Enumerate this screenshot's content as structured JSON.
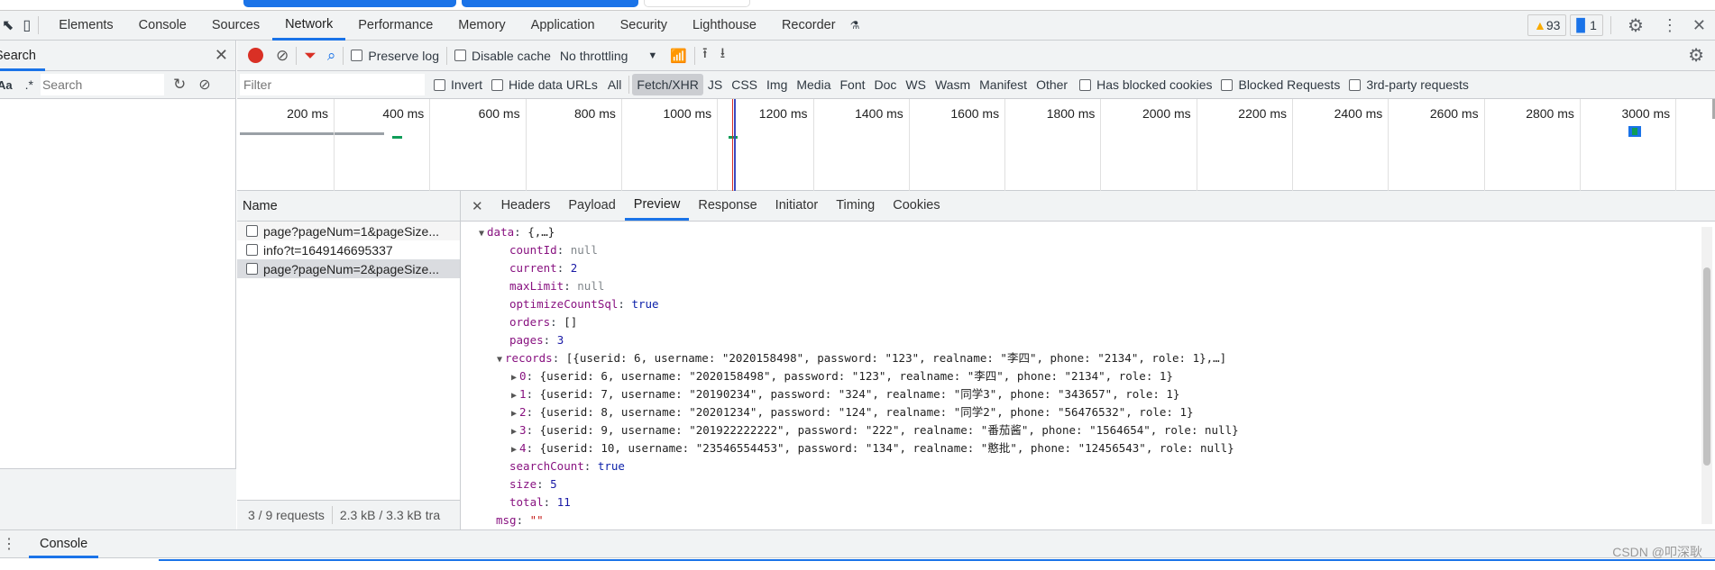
{
  "devtools": {
    "main_tabs": [
      "Elements",
      "Console",
      "Sources",
      "Network",
      "Performance",
      "Memory",
      "Application",
      "Security",
      "Lighthouse",
      "Recorder"
    ],
    "selected_tab": "Network",
    "warnings_count": "93",
    "messages_count": "1"
  },
  "search_panel": {
    "title": "Search",
    "aa_label": "Aa",
    "regex_label": ".*",
    "placeholder": "Search"
  },
  "network_toolbar": {
    "preserve_log": "Preserve log",
    "disable_cache": "Disable cache",
    "throttling": "No throttling"
  },
  "filter_bar": {
    "placeholder": "Filter",
    "invert": "Invert",
    "hide_data_urls": "Hide data URLs",
    "types": [
      "All",
      "Fetch/XHR",
      "JS",
      "CSS",
      "Img",
      "Media",
      "Font",
      "Doc",
      "WS",
      "Wasm",
      "Manifest",
      "Other"
    ],
    "selected_type": "Fetch/XHR",
    "has_blocked_cookies": "Has blocked cookies",
    "blocked_requests": "Blocked Requests",
    "third_party": "3rd-party requests"
  },
  "timeline": {
    "ticks": [
      "200 ms",
      "400 ms",
      "600 ms",
      "800 ms",
      "1000 ms",
      "1200 ms",
      "1400 ms",
      "1600 ms",
      "1800 ms",
      "2000 ms",
      "2200 ms",
      "2400 ms",
      "2600 ms",
      "2800 ms",
      "3000 ms"
    ]
  },
  "requests": {
    "header": "Name",
    "items": [
      "page?pageNum=1&pageSize...",
      "info?t=1649146695337",
      "page?pageNum=2&pageSize..."
    ],
    "selected_index": 2,
    "status": "3 / 9 requests",
    "transfer": "2.3 kB / 3.3 kB tra"
  },
  "detail_tabs": {
    "items": [
      "Headers",
      "Payload",
      "Preview",
      "Response",
      "Initiator",
      "Timing",
      "Cookies"
    ],
    "selected": "Preview"
  },
  "preview": {
    "data_key": "data",
    "data_summary": "{,…}",
    "fields": [
      {
        "k": "countId",
        "v": "null",
        "c": "n"
      },
      {
        "k": "current",
        "v": "2",
        "c": "num"
      },
      {
        "k": "maxLimit",
        "v": "null",
        "c": "n"
      },
      {
        "k": "optimizeCountSql",
        "v": "true",
        "c": "t"
      },
      {
        "k": "orders",
        "v": "[]",
        "c": "p"
      },
      {
        "k": "pages",
        "v": "3",
        "c": "num"
      }
    ],
    "records_key": "records",
    "records_summary": "[{userid: 6, username: \"2020158498\", password: \"123\", realname: \"李四\", phone: \"2134\", role: 1},…]",
    "records": [
      {
        "i": "0",
        "v": "{userid: 6, username: \"2020158498\", password: \"123\", realname: \"李四\", phone: \"2134\", role: 1}"
      },
      {
        "i": "1",
        "v": "{userid: 7, username: \"20190234\", password: \"324\", realname: \"同学3\", phone: \"343657\", role: 1}"
      },
      {
        "i": "2",
        "v": "{userid: 8, username: \"20201234\", password: \"124\", realname: \"同学2\", phone: \"56476532\", role: 1}"
      },
      {
        "i": "3",
        "v": "{userid: 9, username: \"201922222222\", password: \"222\", realname: \"番茄酱\", phone: \"1564654\", role: null}"
      },
      {
        "i": "4",
        "v": "{userid: 10, username: \"23546554453\", password: \"134\", realname: \"憨批\", phone: \"12456543\", role: null}"
      }
    ],
    "after": [
      {
        "k": "searchCount",
        "v": "true",
        "c": "t"
      },
      {
        "k": "size",
        "v": "5",
        "c": "num"
      },
      {
        "k": "total",
        "v": "11",
        "c": "num"
      }
    ],
    "msg_key": "msg",
    "msg_value": "\"\""
  },
  "drawer": {
    "tab": "Console"
  },
  "watermark": "CSDN @叩深耿"
}
